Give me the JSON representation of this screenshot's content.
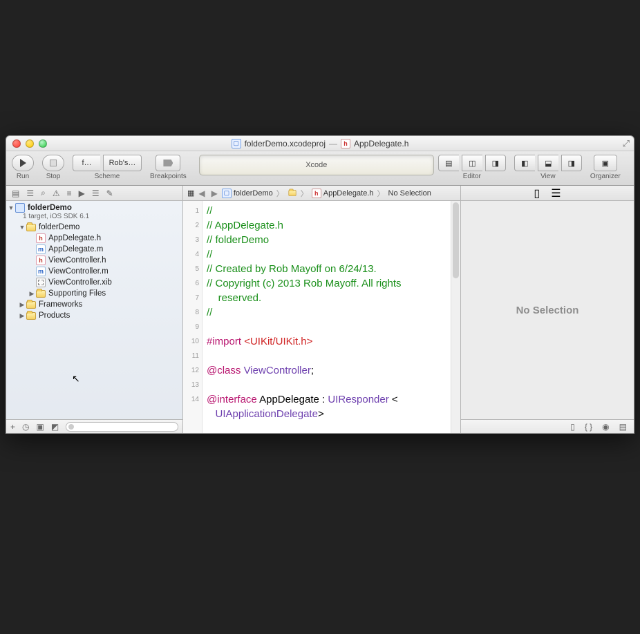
{
  "window": {
    "title_project": "folderDemo.xcodeproj",
    "title_sep": "—",
    "title_file": "AppDelegate.h"
  },
  "toolbar": {
    "run": "Run",
    "stop": "Stop",
    "scheme": "Scheme",
    "scheme_target": "f…",
    "scheme_dest": "Rob's…",
    "breakpoints": "Breakpoints",
    "editor": "Editor",
    "view": "View",
    "organizer": "Organizer",
    "lcd": "Xcode"
  },
  "jumpbar": {
    "project": "folderDemo",
    "file": "AppDelegate.h",
    "selection": "No Selection"
  },
  "navigator": {
    "project": {
      "name": "folderDemo",
      "subtitle": "1 target, iOS SDK 6.1"
    },
    "tree": [
      {
        "type": "folder",
        "name": "folderDemo",
        "open": true,
        "indent": 1
      },
      {
        "type": "h",
        "name": "AppDelegate.h",
        "indent": 2
      },
      {
        "type": "m",
        "name": "AppDelegate.m",
        "indent": 2
      },
      {
        "type": "h",
        "name": "ViewController.h",
        "indent": 2
      },
      {
        "type": "m",
        "name": "ViewController.m",
        "indent": 2
      },
      {
        "type": "xib",
        "name": "ViewController.xib",
        "indent": 2
      },
      {
        "type": "folder",
        "name": "Supporting Files",
        "open": false,
        "indent": 2
      },
      {
        "type": "folder",
        "name": "Frameworks",
        "open": false,
        "indent": 1
      },
      {
        "type": "folder",
        "name": "Products",
        "open": false,
        "indent": 1
      }
    ]
  },
  "code": {
    "lines": [
      {
        "t": "c",
        "text": "//"
      },
      {
        "t": "c",
        "text": "//  AppDelegate.h"
      },
      {
        "t": "c",
        "text": "//  folderDemo"
      },
      {
        "t": "c",
        "text": "//"
      },
      {
        "t": "c",
        "text": "//  Created by Rob Mayoff on 6/24/13."
      },
      {
        "t": "cwrap",
        "a": "//  Copyright (c) 2013 Rob Mayoff. All rights",
        "b": "reserved."
      },
      {
        "t": "c",
        "text": "//"
      },
      {
        "t": "blank"
      },
      {
        "t": "import",
        "pre": "#import ",
        "str": "<UIKit/UIKit.h>"
      },
      {
        "t": "blank"
      },
      {
        "t": "class",
        "kw": "@class",
        "ty": " ViewController",
        "post": ";"
      },
      {
        "t": "blank"
      },
      {
        "t": "iface",
        "kw": "@interface",
        "name": " AppDelegate : ",
        "ty1": "UIResponder",
        "post1": " <",
        "ty2": "UIApplicationDelegate",
        "post2": ">"
      },
      {
        "t": "blank"
      }
    ],
    "line_numbers": [
      "1",
      "2",
      "3",
      "4",
      "5",
      "6",
      "",
      "7",
      "8",
      "9",
      "10",
      "11",
      "12",
      "13",
      "",
      "14"
    ]
  },
  "inspector": {
    "empty": "No Selection"
  }
}
